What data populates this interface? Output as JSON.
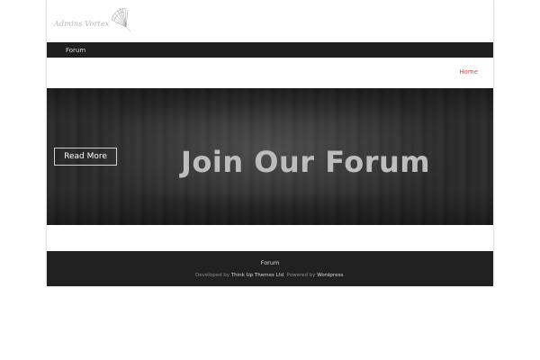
{
  "site": {
    "logo_text": "Admins Vortex",
    "logo_icon": "radial-fan-icon"
  },
  "topbar": {
    "link": "Forum"
  },
  "breadcrumb": {
    "home": "Home"
  },
  "hero": {
    "button_label": "Read More",
    "title": "Join Our Forum"
  },
  "footer": {
    "link": "Forum",
    "developed_by": "Developed by ",
    "developer": "Think Up Themes Ltd",
    "powered_by": ". Powered by ",
    "platform": "Wordpress",
    "end": "."
  },
  "colors": {
    "accent": "#e5473f",
    "bar": "#1f1f1f",
    "footer": "#212121"
  }
}
